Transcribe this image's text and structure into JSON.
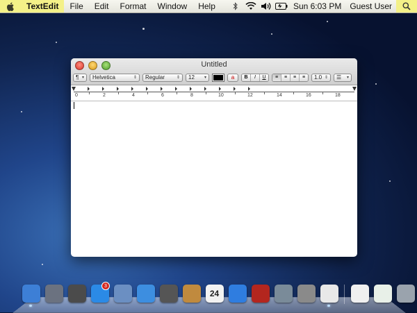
{
  "menubar": {
    "app_name": "TextEdit",
    "menus": [
      "File",
      "Edit",
      "Format",
      "Window",
      "Help"
    ],
    "clock": "Sun 6:03 PM",
    "user": "Guest User",
    "status_icons": [
      "bluetooth-icon",
      "wifi-icon",
      "volume-icon",
      "battery-icon"
    ]
  },
  "window": {
    "title": "Untitled",
    "toolbar": {
      "paragraph_style_label": "¶",
      "font_family": "Helvetica",
      "font_style": "Regular",
      "font_size": "12",
      "text_color": "#000000",
      "bold_label": "B",
      "italic_label": "I",
      "underline_label": "U",
      "line_spacing": "1.0"
    },
    "ruler": {
      "numbers": [
        "0",
        "2",
        "4",
        "6",
        "8",
        "10",
        "12",
        "14",
        "16",
        "18"
      ]
    }
  },
  "dock": {
    "apps": [
      {
        "name": "finder-icon",
        "color": "#3d7fd6"
      },
      {
        "name": "launchpad-icon",
        "color": "#6b7280"
      },
      {
        "name": "mission-control-icon",
        "color": "#4b4b4b"
      },
      {
        "name": "app-store-icon",
        "color": "#2b8ae6",
        "badge": "3"
      },
      {
        "name": "mail-icon",
        "color": "#6b8fc2"
      },
      {
        "name": "safari-icon",
        "color": "#3d8ee0"
      },
      {
        "name": "facetime-icon",
        "color": "#555555"
      },
      {
        "name": "contacts-icon",
        "color": "#c08a3e"
      },
      {
        "name": "calendar-icon",
        "color": "#f2f2f2",
        "text": "24"
      },
      {
        "name": "itunes-icon",
        "color": "#2f7de0"
      },
      {
        "name": "photo-booth-icon",
        "color": "#b3261e"
      },
      {
        "name": "iphoto-icon",
        "color": "#7a8b99"
      },
      {
        "name": "system-preferences-icon",
        "color": "#8a8a8a"
      },
      {
        "name": "textedit-icon",
        "color": "#e8e8e8"
      }
    ],
    "right": [
      {
        "name": "documents-stack-icon",
        "color": "#f0f0f0"
      },
      {
        "name": "downloads-stack-icon",
        "color": "#e8f0e8"
      },
      {
        "name": "trash-icon",
        "color": "#9aa3ad"
      }
    ]
  }
}
